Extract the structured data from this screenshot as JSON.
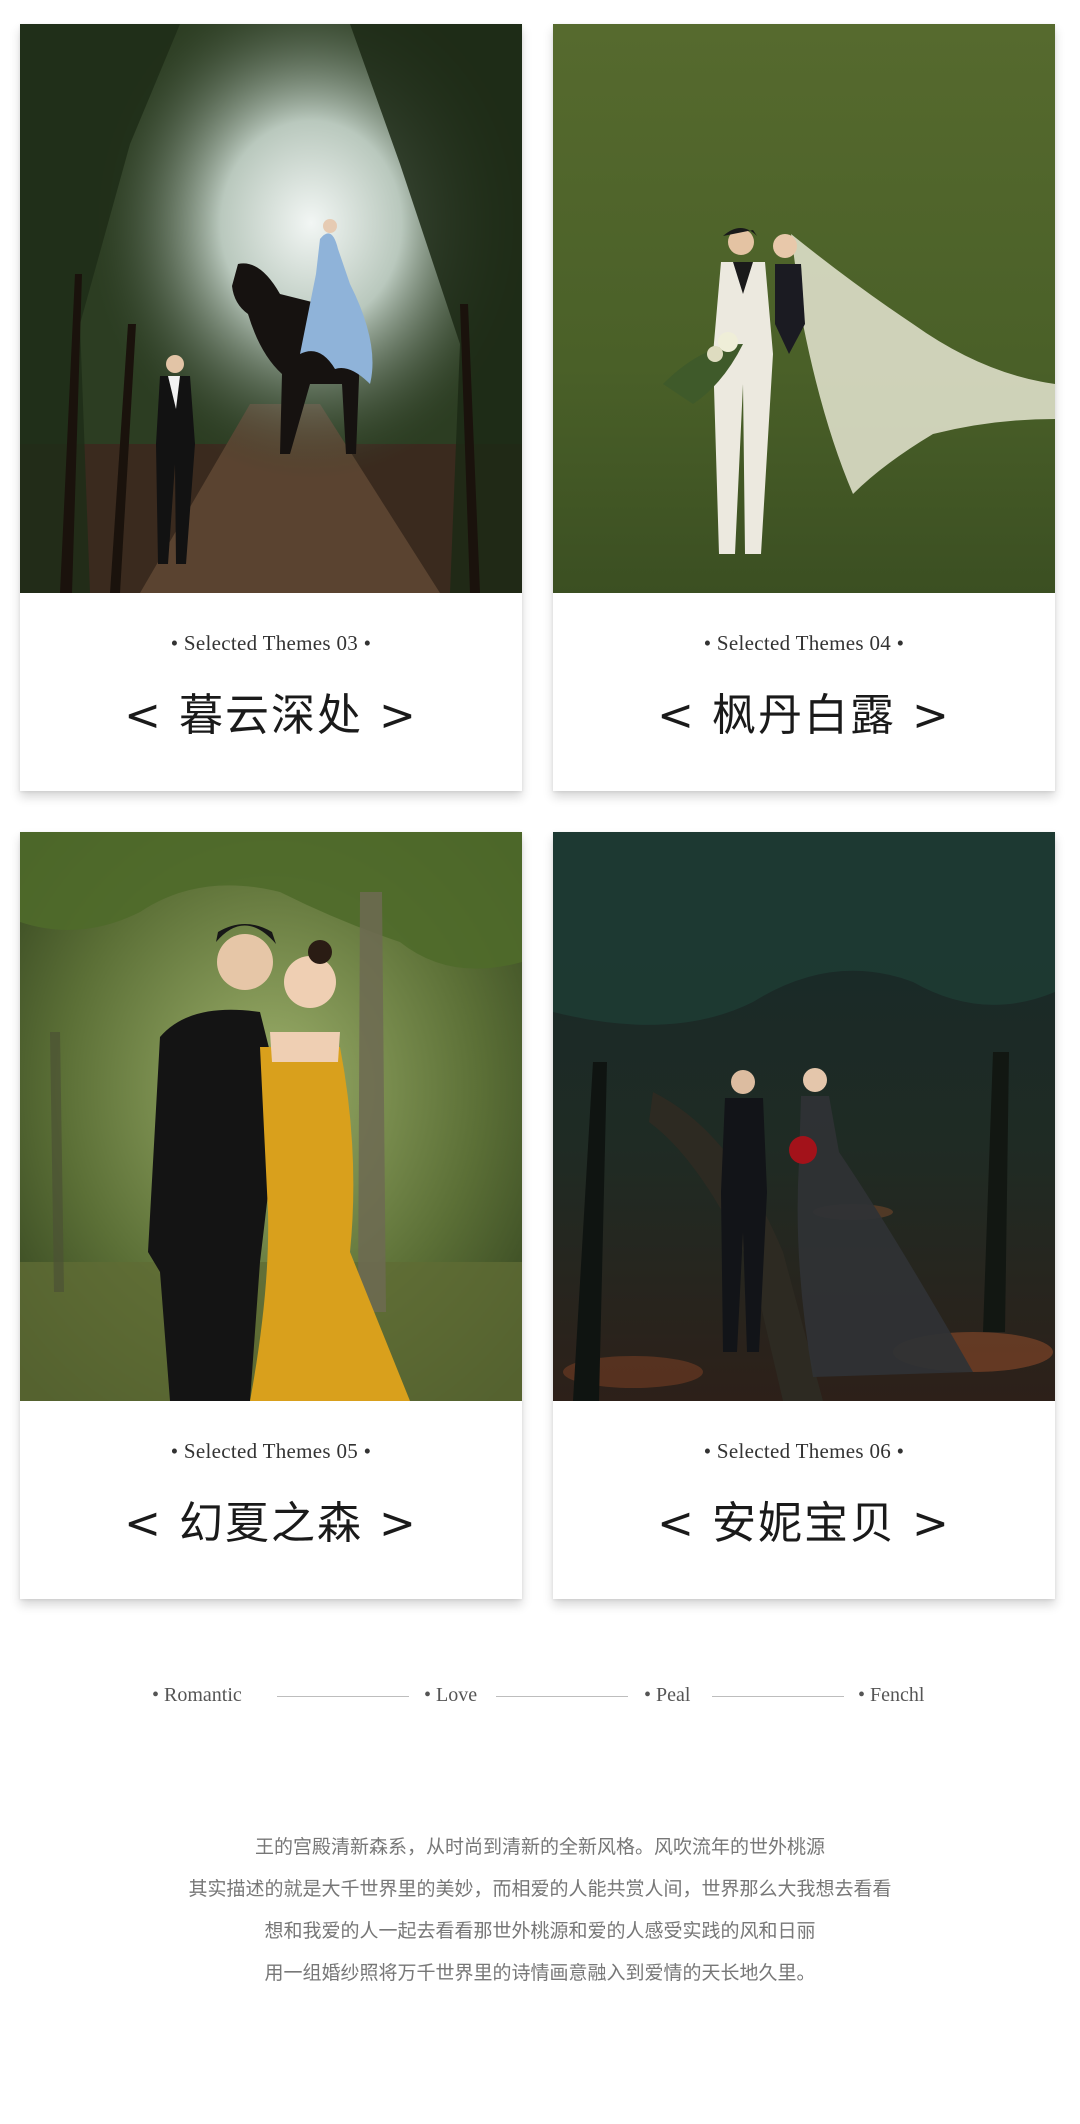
{
  "cards": [
    {
      "subtitle": "• Selected Themes 03 •",
      "title": "< 暮云深处 >",
      "photo": "couple-with-horse-forest-photo"
    },
    {
      "subtitle": "• Selected Themes 04 •",
      "title": "< 枫丹白露 >",
      "photo": "couple-on-lawn-with-veil-photo"
    },
    {
      "subtitle": "• Selected Themes 05 •",
      "title": "< 幻夏之森 >",
      "photo": "couple-yellow-dress-forest-photo"
    },
    {
      "subtitle": "• Selected Themes 06 •",
      "title": "< 安妮宝贝 >",
      "photo": "couple-dark-forest-photo"
    }
  ],
  "tags": [
    "• Romantic",
    "• Love",
    "• Peal",
    "• Fenchl"
  ],
  "paragraph": [
    "王的宫殿清新森系，从时尚到清新的全新风格。风吹流年的世外桃源",
    "其实描述的就是大千世界里的美妙，而相爱的人能共赏人间，世界那么大我想去看看",
    "想和我爱的人一起去看看那世外桃源和爱的人感受实践的风和日丽",
    "用一组婚纱照将万千世界里的诗情画意融入到爱情的天长地久里。"
  ],
  "colors": {
    "background": "#ffffff",
    "title_text": "#1a1a1a",
    "paragraph_text": "#777777",
    "divider": "#bdbdbd"
  }
}
